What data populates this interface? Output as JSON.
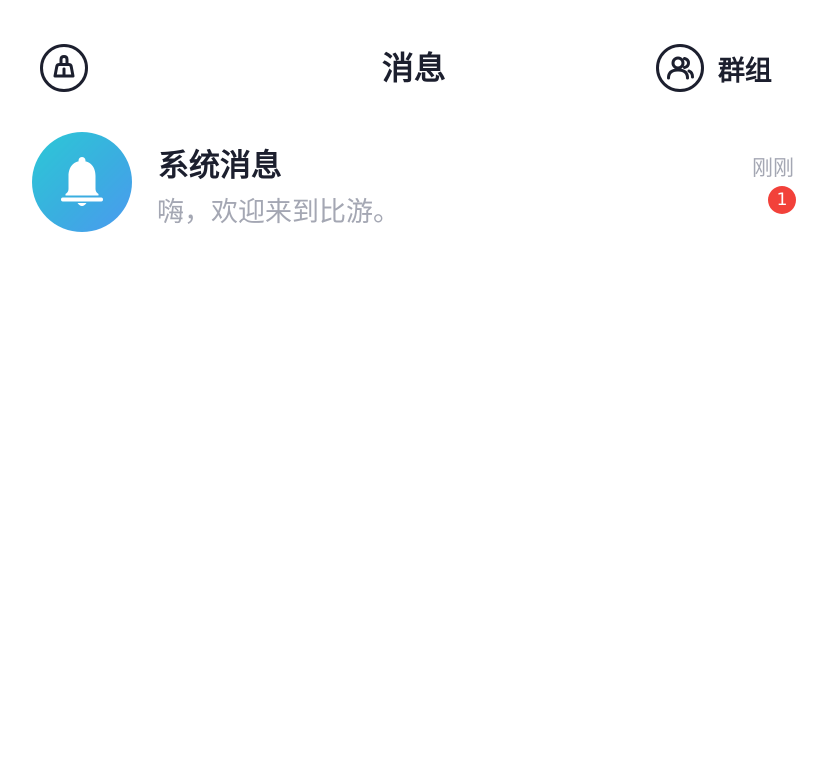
{
  "header": {
    "title": "消息",
    "clean_icon": "broom-clean-icon",
    "group_icon": "users-group-icon",
    "group_label": "群组"
  },
  "messages": [
    {
      "icon": "bell-icon",
      "title": "系统消息",
      "preview": "嗨，欢迎来到比游。",
      "time": "刚刚",
      "unread": "1"
    }
  ],
  "colors": {
    "text_primary": "#1c1f2e",
    "text_secondary": "#a4a7b3",
    "badge": "#f2413a",
    "avatar_gradient_start": "#2cc8d6",
    "avatar_gradient_end": "#4b9af0"
  }
}
